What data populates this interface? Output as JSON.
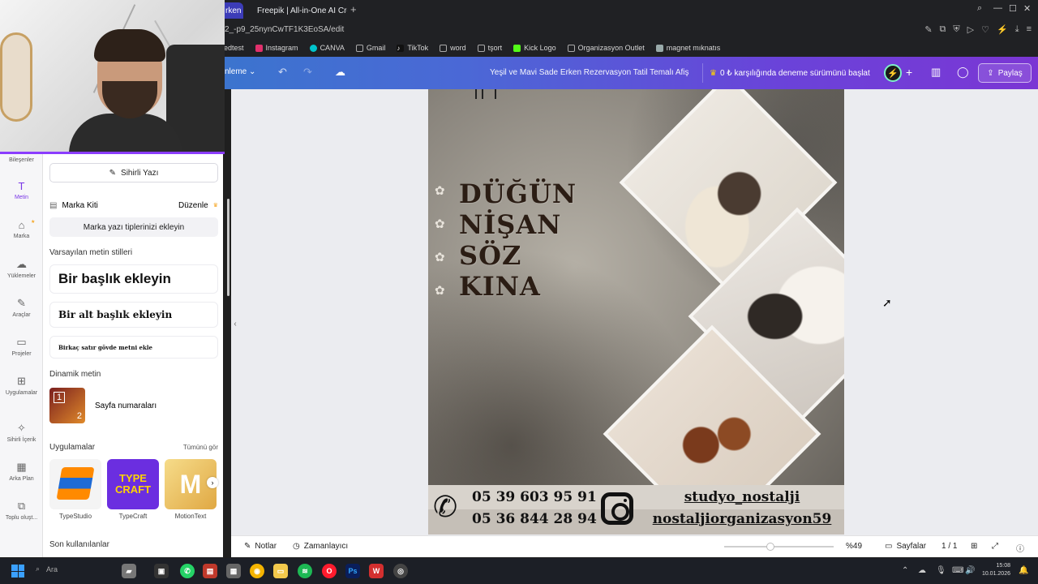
{
  "browser": {
    "tabs": [
      {
        "label": "rken",
        "active": true
      },
      {
        "label": "Freepik | All-in-One AI Cre",
        "active": false
      }
    ],
    "url": "2_-p9_25nynCwTF1K3EoSA/edit",
    "bookmarks": [
      {
        "label": "edtest",
        "icon": "page-icon"
      },
      {
        "label": "Instagram",
        "icon": "instagram-icon"
      },
      {
        "label": "CANVA",
        "icon": "canva-icon"
      },
      {
        "label": "Gmail",
        "icon": "page-icon"
      },
      {
        "label": "TikTok",
        "icon": "tiktok-icon"
      },
      {
        "label": "word",
        "icon": "page-icon"
      },
      {
        "label": "tşort",
        "icon": "page-icon"
      },
      {
        "label": "Kick Logo",
        "icon": "kick-icon"
      },
      {
        "label": "Organizasyon Outlet",
        "icon": "page-icon"
      },
      {
        "label": "magnet mıknatıs",
        "icon": "image-icon"
      }
    ]
  },
  "header": {
    "menu_label": "nleme",
    "doc_title": "Yeşil ve Mavi Sade Erken Rezervasyon Tatil Temalı Afiş",
    "trial_label": "0 ₺ karşılığında deneme sürümünü başlat",
    "share_label": "Paylaş"
  },
  "rail": {
    "items": [
      {
        "label": "Bileşenler",
        "icon": "shapes-icon"
      },
      {
        "label": "Metin",
        "icon": "text-icon",
        "active": true
      },
      {
        "label": "Marka",
        "icon": "brand-icon"
      },
      {
        "label": "Yüklemeler",
        "icon": "cloud-upload-icon"
      },
      {
        "label": "Araçlar",
        "icon": "pen-icon"
      },
      {
        "label": "Projeler",
        "icon": "folder-icon"
      },
      {
        "label": "Uygulamalar",
        "icon": "apps-icon"
      },
      {
        "label": "Sihirli İçerik",
        "icon": "magic-media-icon"
      },
      {
        "label": "Arka Plan",
        "icon": "background-icon"
      },
      {
        "label": "Toplu oluşt...",
        "icon": "bulk-create-icon"
      }
    ]
  },
  "panel": {
    "magic_write": "Sihirli Yazı",
    "brand_kit": "Marka Kiti",
    "brand_edit": "Düzenle",
    "brand_fonts": "Marka yazı tiplerinizi ekleyin",
    "default_styles": "Varsayılan metin stilleri",
    "heading": "Bir başlık ekleyin",
    "subheading": "Bir alt başlık ekleyin",
    "body": "Birkaç satır gövde metni ekle",
    "dynamic_text": "Dinamik metin",
    "page_numbers": "Sayfa numaraları",
    "apps_label": "Uygulamalar",
    "see_all": "Tümünü gör",
    "apps": [
      {
        "name": "TypeStudio"
      },
      {
        "name": "TypeCraft",
        "logo_text": "TYPE CRAFT"
      },
      {
        "name": "MotionText",
        "logo_text": "M"
      }
    ],
    "recent": "Son kullanılanlar"
  },
  "poster": {
    "lines": [
      "DÜĞÜN",
      "NİŞAN",
      "SÖZ",
      "KINA"
    ],
    "phones": [
      "05 39 603 95 91",
      "05 36 844 28 94"
    ],
    "handles": [
      "studyo_nostalji",
      "nostaljiorganizasyon59"
    ]
  },
  "bottombar": {
    "notes": "Notlar",
    "timer": "Zamanlayıcı",
    "zoom": "%49",
    "zoom_level": 0.38,
    "pages": "Sayfalar",
    "page_count": "1 / 1"
  },
  "taskbar": {
    "search_placeholder": "Ara",
    "time": "15:08",
    "date": "10.01.2026"
  }
}
